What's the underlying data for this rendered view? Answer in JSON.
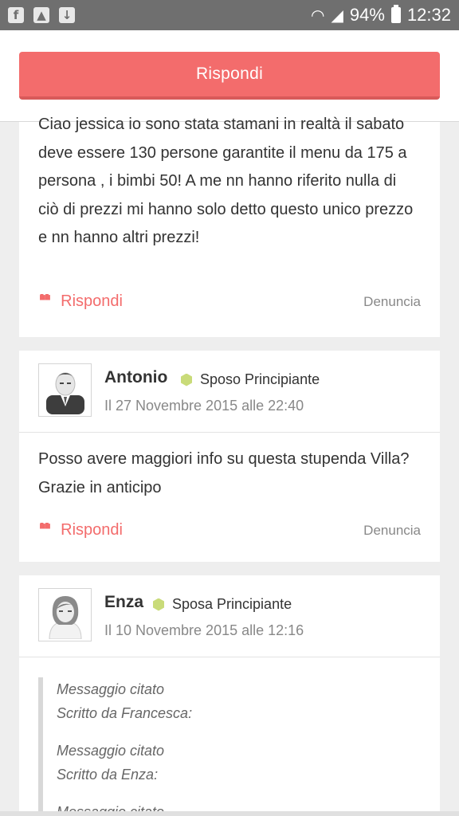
{
  "status_bar": {
    "battery": "94%",
    "time": "12:32",
    "icons": [
      "facebook-icon",
      "gallery-icon",
      "download-icon",
      "wifi-icon",
      "signal-icon",
      "battery-icon"
    ]
  },
  "header": {
    "reply_button": "Rispondi"
  },
  "colors": {
    "accent": "#f36c6c",
    "badge": "#c9db79"
  },
  "posts": [
    {
      "body": "Ciao jessica io sono stata stamani in realtà il sabato deve essere 130 persone garantite il menu da 175 a persona , i bimbi 50! A me nn hanno riferito nulla di ciò di prezzi mi hanno solo detto questo unico prezzo e nn hanno altri prezzi!",
      "reply": "Rispondi",
      "report": "Denuncia"
    },
    {
      "author": "Antonio",
      "role": "Sposo Principiante",
      "date": "Il 27 Novembre 2015 alle 22:40",
      "body": "Posso avere maggiori info su questa stupenda Villa? Grazie in anticipo",
      "reply": "Rispondi",
      "report": "Denuncia"
    },
    {
      "author": "Enza",
      "role": "Sposa Principiante",
      "date": "Il 10 Novembre 2015 alle 12:16",
      "quotes": [
        {
          "label": "Messaggio citato",
          "by": "Scritto da Francesca:"
        },
        {
          "label": "Messaggio citato",
          "by": "Scritto da Enza:"
        },
        {
          "label": "Messaggio citato",
          "by": ""
        }
      ]
    }
  ]
}
